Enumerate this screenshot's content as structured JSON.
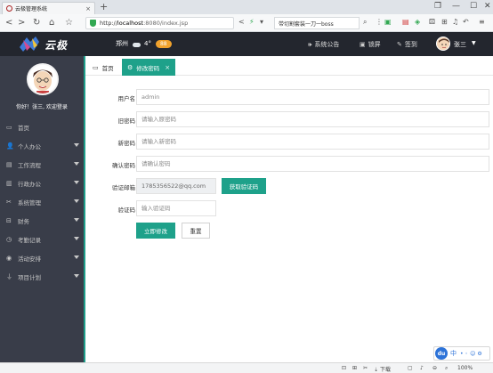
{
  "browser": {
    "tab_title": "云极管理系统",
    "tab_close": "×",
    "new_tab": "+",
    "url_prefix": "http://",
    "url_host": "localhost",
    "url_rest": ":8080/index.jsp",
    "search_text": "带切割套装一刀一boss"
  },
  "header": {
    "logo_text": "云极",
    "city": "郑州",
    "temperature": "4°",
    "aqi": "88",
    "announcement": "系统公告",
    "lock": "锁屏",
    "checkin": "签到",
    "username": "张三"
  },
  "sidebar": {
    "greeting": "你好！张三, 欢迎登录",
    "items": [
      {
        "label": "首页",
        "icon": "monitor-icon",
        "has_arrow": false
      },
      {
        "label": "个人办公",
        "icon": "user-icon",
        "has_arrow": true
      },
      {
        "label": "工作流程",
        "icon": "document-icon",
        "has_arrow": true
      },
      {
        "label": "行政办公",
        "icon": "folder-icon",
        "has_arrow": true
      },
      {
        "label": "系统管理",
        "icon": "tools-icon",
        "has_arrow": true
      },
      {
        "label": "财务",
        "icon": "finance-icon",
        "has_arrow": true
      },
      {
        "label": "考勤记录",
        "icon": "clock-icon",
        "has_arrow": true
      },
      {
        "label": "活动安排",
        "icon": "calendar-icon",
        "has_arrow": true
      },
      {
        "label": "项目计划",
        "icon": "plan-icon",
        "has_arrow": true
      }
    ]
  },
  "tabs": [
    {
      "label": "首页",
      "icon": "home-icon",
      "active": false
    },
    {
      "label": "修改密码",
      "icon": "gear-icon",
      "active": true,
      "close": "×"
    }
  ],
  "form": {
    "username": {
      "label": "用户名",
      "value": "",
      "placeholder": "admin"
    },
    "old_password": {
      "label": "旧密码",
      "value": "",
      "placeholder": "请输入原密码"
    },
    "new_password": {
      "label": "新密码",
      "value": "",
      "placeholder": "请输入新密码"
    },
    "confirm_password": {
      "label": "确认密码",
      "value": "",
      "placeholder": "请确认密码"
    },
    "email": {
      "label": "验证邮箱",
      "value": "1785356522@qq.com",
      "button": "获取验证码"
    },
    "code": {
      "label": "验证码",
      "value": "",
      "placeholder": "输入验证码"
    },
    "submit": "立即修改",
    "reset": "重置"
  },
  "statusbar": {
    "download": "下载",
    "zoom": "100%"
  },
  "ime": {
    "logo": "du",
    "mode": "中"
  },
  "colors": {
    "accent": "#1ea18a",
    "sidebar_bg": "#393d49",
    "header_bg": "#23262e"
  }
}
